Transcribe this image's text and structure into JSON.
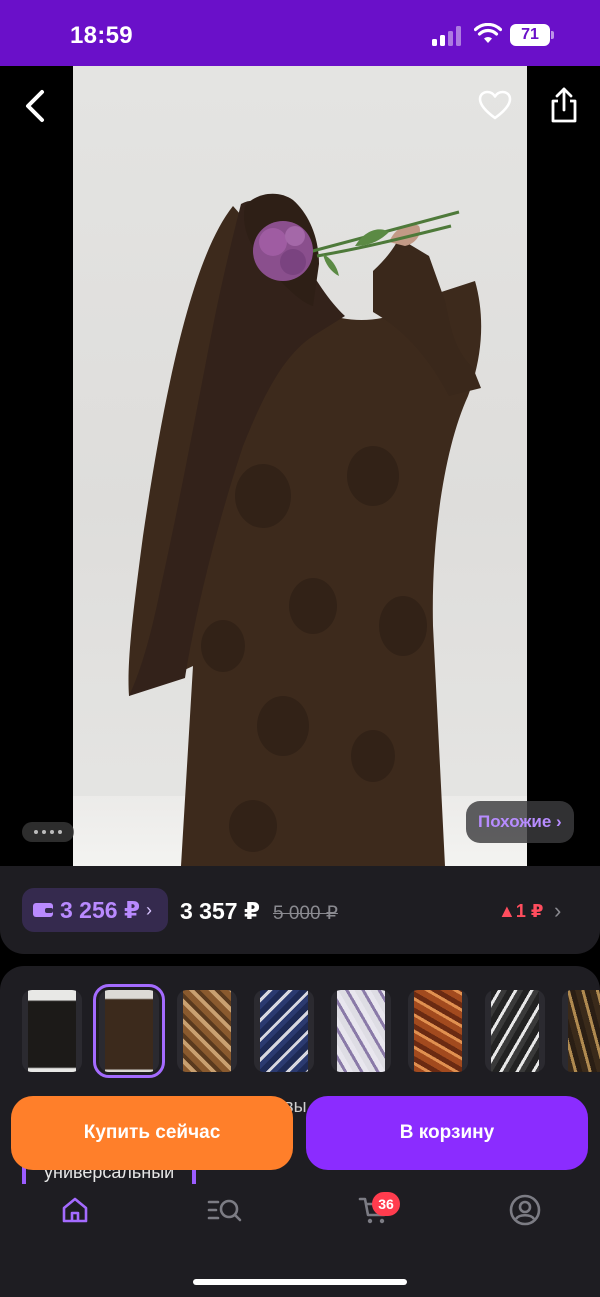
{
  "status_bar": {
    "time": "18:59",
    "battery": "71",
    "icons": [
      "signal-icon",
      "wifi-icon",
      "battery-icon"
    ]
  },
  "gallery": {
    "icons": [
      "back-arrow-icon",
      "heart-icon",
      "share-icon"
    ],
    "similar_label": "Похожие ›"
  },
  "price": {
    "wallet_amount": "3 256 ₽",
    "wallet_chevron": "›",
    "current": "3 357 ₽",
    "old": "5 000 ₽",
    "difference": "▲1 ₽",
    "more": "›"
  },
  "variants": {
    "count": 8,
    "selected_index": 1
  },
  "behind_content": {
    "fragment": "вы",
    "option_label": "универсальный"
  },
  "actions": {
    "buy_now": "Купить сейчас",
    "add_to_cart": "В корзину"
  },
  "bottom_nav": {
    "items": [
      "home-icon",
      "catalog-search-icon",
      "cart-icon",
      "profile-icon"
    ],
    "cart_badge": "36"
  },
  "colors": {
    "status_bar": "#6a10c9",
    "accent_purple": "#8b2cff",
    "accent_orange": "#ff7f2a",
    "price_up": "#ff4d5e",
    "card_bg": "#1e1d22"
  }
}
